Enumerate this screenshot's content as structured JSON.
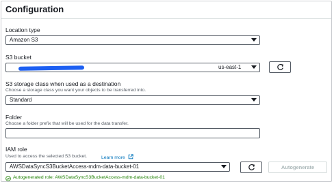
{
  "header": {
    "title": "Configuration"
  },
  "location_type": {
    "label": "Location type",
    "value": "Amazon S3"
  },
  "s3_bucket": {
    "label": "S3 bucket",
    "region": "us-east-1"
  },
  "storage_class": {
    "label": "S3 storage class when used as a destination",
    "description": "Choose a storage class you want your objects to be transferred into.",
    "value": "Standard"
  },
  "folder": {
    "label": "Folder",
    "description": "Choose a folder prefix that will be used for the data transfer.",
    "value": ""
  },
  "iam_role": {
    "label": "IAM role",
    "description": "Used to access the selected S3 bucket.",
    "learn_more": "Learn more",
    "value": "AWSDataSyncS3BucketAccess-mdm-data-bucket-01",
    "autogenerate_label": "Autogenerate",
    "success_text": "Autogenerated role: AWSDataSyncS3BucketAccess-mdm-data-bucket-01"
  },
  "colors": {
    "link": "#0073bb",
    "success": "#1d8102",
    "redaction": "#1c5ff2"
  },
  "icons": [
    "refresh-icon",
    "external-link-icon",
    "check-circle-icon",
    "caret-down-icon"
  ]
}
